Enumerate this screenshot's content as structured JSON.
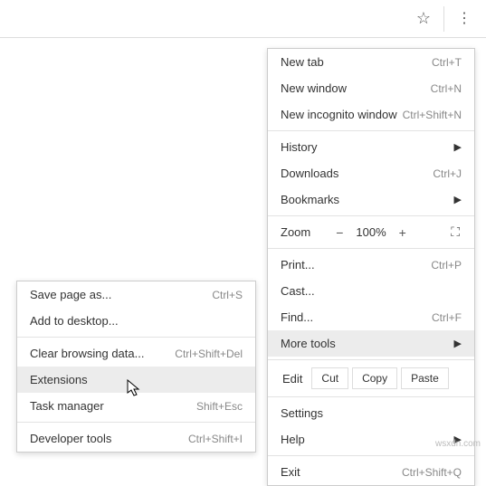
{
  "toolbar": {
    "star_icon": "☆",
    "dots_icon": "⋮"
  },
  "menu": {
    "new_tab": {
      "label": "New tab",
      "shortcut": "Ctrl+T"
    },
    "new_window": {
      "label": "New window",
      "shortcut": "Ctrl+N"
    },
    "new_incognito": {
      "label": "New incognito window",
      "shortcut": "Ctrl+Shift+N"
    },
    "history": {
      "label": "History"
    },
    "downloads": {
      "label": "Downloads",
      "shortcut": "Ctrl+J"
    },
    "bookmarks": {
      "label": "Bookmarks"
    },
    "zoom": {
      "label": "Zoom",
      "minus": "−",
      "value": "100%",
      "plus": "+"
    },
    "print": {
      "label": "Print...",
      "shortcut": "Ctrl+P"
    },
    "cast": {
      "label": "Cast..."
    },
    "find": {
      "label": "Find...",
      "shortcut": "Ctrl+F"
    },
    "more_tools": {
      "label": "More tools"
    },
    "edit": {
      "label": "Edit",
      "cut": "Cut",
      "copy": "Copy",
      "paste": "Paste"
    },
    "settings": {
      "label": "Settings"
    },
    "help": {
      "label": "Help"
    },
    "exit": {
      "label": "Exit",
      "shortcut": "Ctrl+Shift+Q"
    }
  },
  "submenu": {
    "save_as": {
      "label": "Save page as...",
      "shortcut": "Ctrl+S"
    },
    "add_desktop": {
      "label": "Add to desktop..."
    },
    "clear_data": {
      "label": "Clear browsing data...",
      "shortcut": "Ctrl+Shift+Del"
    },
    "extensions": {
      "label": "Extensions"
    },
    "task_manager": {
      "label": "Task manager",
      "shortcut": "Shift+Esc"
    },
    "dev_tools": {
      "label": "Developer tools",
      "shortcut": "Ctrl+Shift+I"
    }
  },
  "watermark": "wsxdn.com"
}
